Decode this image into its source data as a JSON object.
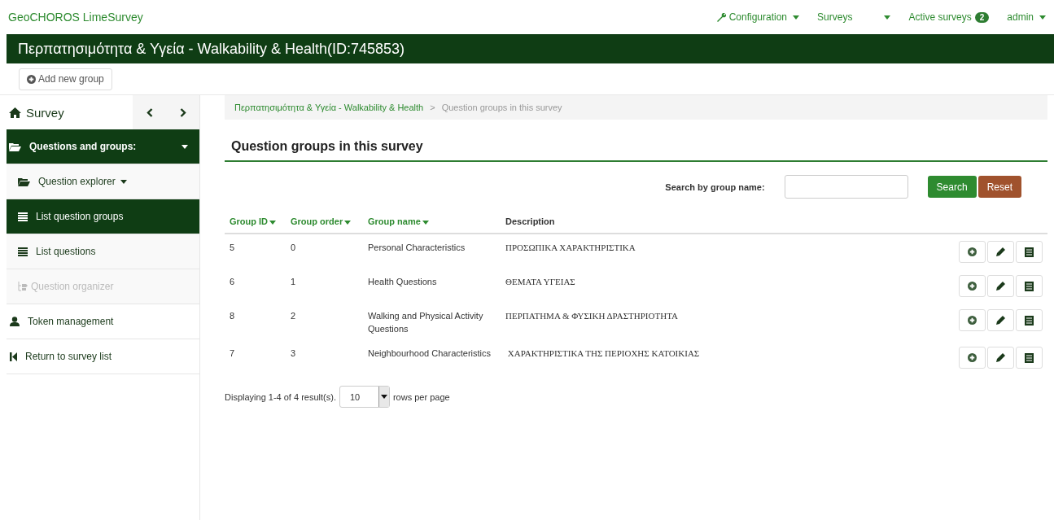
{
  "navbar": {
    "brand": "GeoCHOROS LimeSurvey",
    "menu": [
      {
        "kind": "wrench",
        "label": "Configuration"
      },
      {
        "kind": "split",
        "label": "Surveys"
      },
      {
        "kind": "plain",
        "label": "Active surveys",
        "badge": "2"
      },
      {
        "kind": "caret",
        "label": "admin"
      }
    ]
  },
  "survey_title": "Περπατησιμότητα & Υγεία - Walkability & Health(ID:745853)",
  "toolbar": {
    "add_button": "Add new group"
  },
  "sidebar": {
    "title": "Survey",
    "items": [
      {
        "kind": "section",
        "label": "Questions and groups:",
        "selected": true,
        "disabled": false,
        "caret": true
      },
      {
        "kind": "sub",
        "label": "Question explorer",
        "selected": false,
        "disabled": false,
        "caret": true
      },
      {
        "kind": "sub",
        "label": "List question groups",
        "selected": true,
        "disabled": false,
        "caret": false
      },
      {
        "kind": "sub",
        "label": "List questions",
        "selected": false,
        "disabled": false,
        "caret": false
      },
      {
        "kind": "sub",
        "label": "Question organizer",
        "selected": false,
        "disabled": true,
        "caret": false
      },
      {
        "kind": "item",
        "label": "Token management",
        "selected": false,
        "disabled": false,
        "caret": false
      },
      {
        "kind": "item",
        "label": "Return to survey list",
        "selected": false,
        "disabled": false,
        "caret": false
      }
    ]
  },
  "breadcrumb": {
    "items": [
      "Περπατησιμότητα & Υγεία - Walkability & Health",
      "Question groups in this survey"
    ],
    "separator": ">"
  },
  "heading": "Question groups in this survey",
  "search": {
    "label": "Search by group name:",
    "search_button": "Search",
    "reset_button": "Reset"
  },
  "table": {
    "columns": [
      {
        "label": "Group ID",
        "sortable": true
      },
      {
        "label": "Group order",
        "sortable": true
      },
      {
        "label": "Group name",
        "sortable": true
      },
      {
        "label": "Description",
        "sortable": false
      }
    ],
    "rows": [
      {
        "id": "5",
        "order": "0",
        "name": "Personal Characteristics",
        "description": "ΠΡΟΣΩΠΙΚΑ ΧΑΡΑΚΤΗΡΙΣΤΙΚΑ"
      },
      {
        "id": "6",
        "order": "1",
        "name": "Health Questions",
        "description": "ΘΕΜΑΤΑ ΥΓΕΙΑΣ"
      },
      {
        "id": "8",
        "order": "2",
        "name": "Walking and Physical Activity Questions",
        "description": "ΠΕΡΠΑΤΗΜΑ & ΦΥΣΙΚΗ ΔΡΑΣΤΗΡΙΟΤΗΤΑ"
      },
      {
        "id": "7",
        "order": "3",
        "name": "Neighbourhood Characteristics",
        "description": " ΧΑΡΑΚΤΗΡΙΣΤΙΚΑ ΤΗΣ ΠΕΡΙΟΧΗΣ ΚΑΤΟΙΚΙΑΣ"
      }
    ]
  },
  "pager": {
    "summary": "Displaying 1-4 of 4 result(s).",
    "page_size": "10",
    "suffix": "rows per page"
  }
}
